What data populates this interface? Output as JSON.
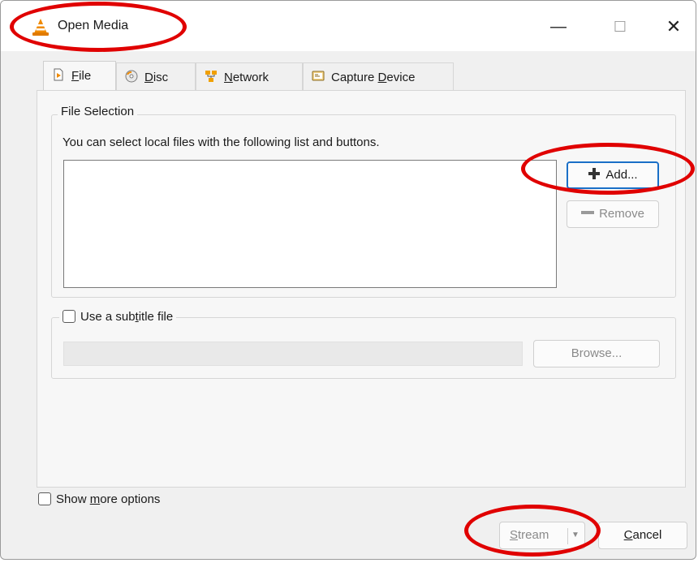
{
  "window": {
    "title": "Open Media",
    "controls": {
      "minimize": "—",
      "maximize": "☐",
      "close": "✕"
    }
  },
  "tabs": [
    {
      "id": "file",
      "label": "File",
      "accel": "F",
      "icon": "file-icon"
    },
    {
      "id": "disc",
      "label": "Disc",
      "accel": "D",
      "icon": "disc-icon"
    },
    {
      "id": "network",
      "label": "Network",
      "accel": "N",
      "icon": "network-icon"
    },
    {
      "id": "capture",
      "label": "Capture Device",
      "accel": "D",
      "icon": "capture-device-icon"
    }
  ],
  "file_selection": {
    "legend": "File Selection",
    "description": "You can select local files with the following list and buttons.",
    "add_label": "Add...",
    "remove_label": "Remove"
  },
  "subtitle": {
    "label": "Use a subtitle file",
    "browse_label": "Browse..."
  },
  "options": {
    "more_label": "Show more options"
  },
  "footer": {
    "stream_label": "Stream",
    "cancel_label": "Cancel"
  },
  "colors": {
    "annotation": "#e00000",
    "focus": "#1a6fc7"
  }
}
